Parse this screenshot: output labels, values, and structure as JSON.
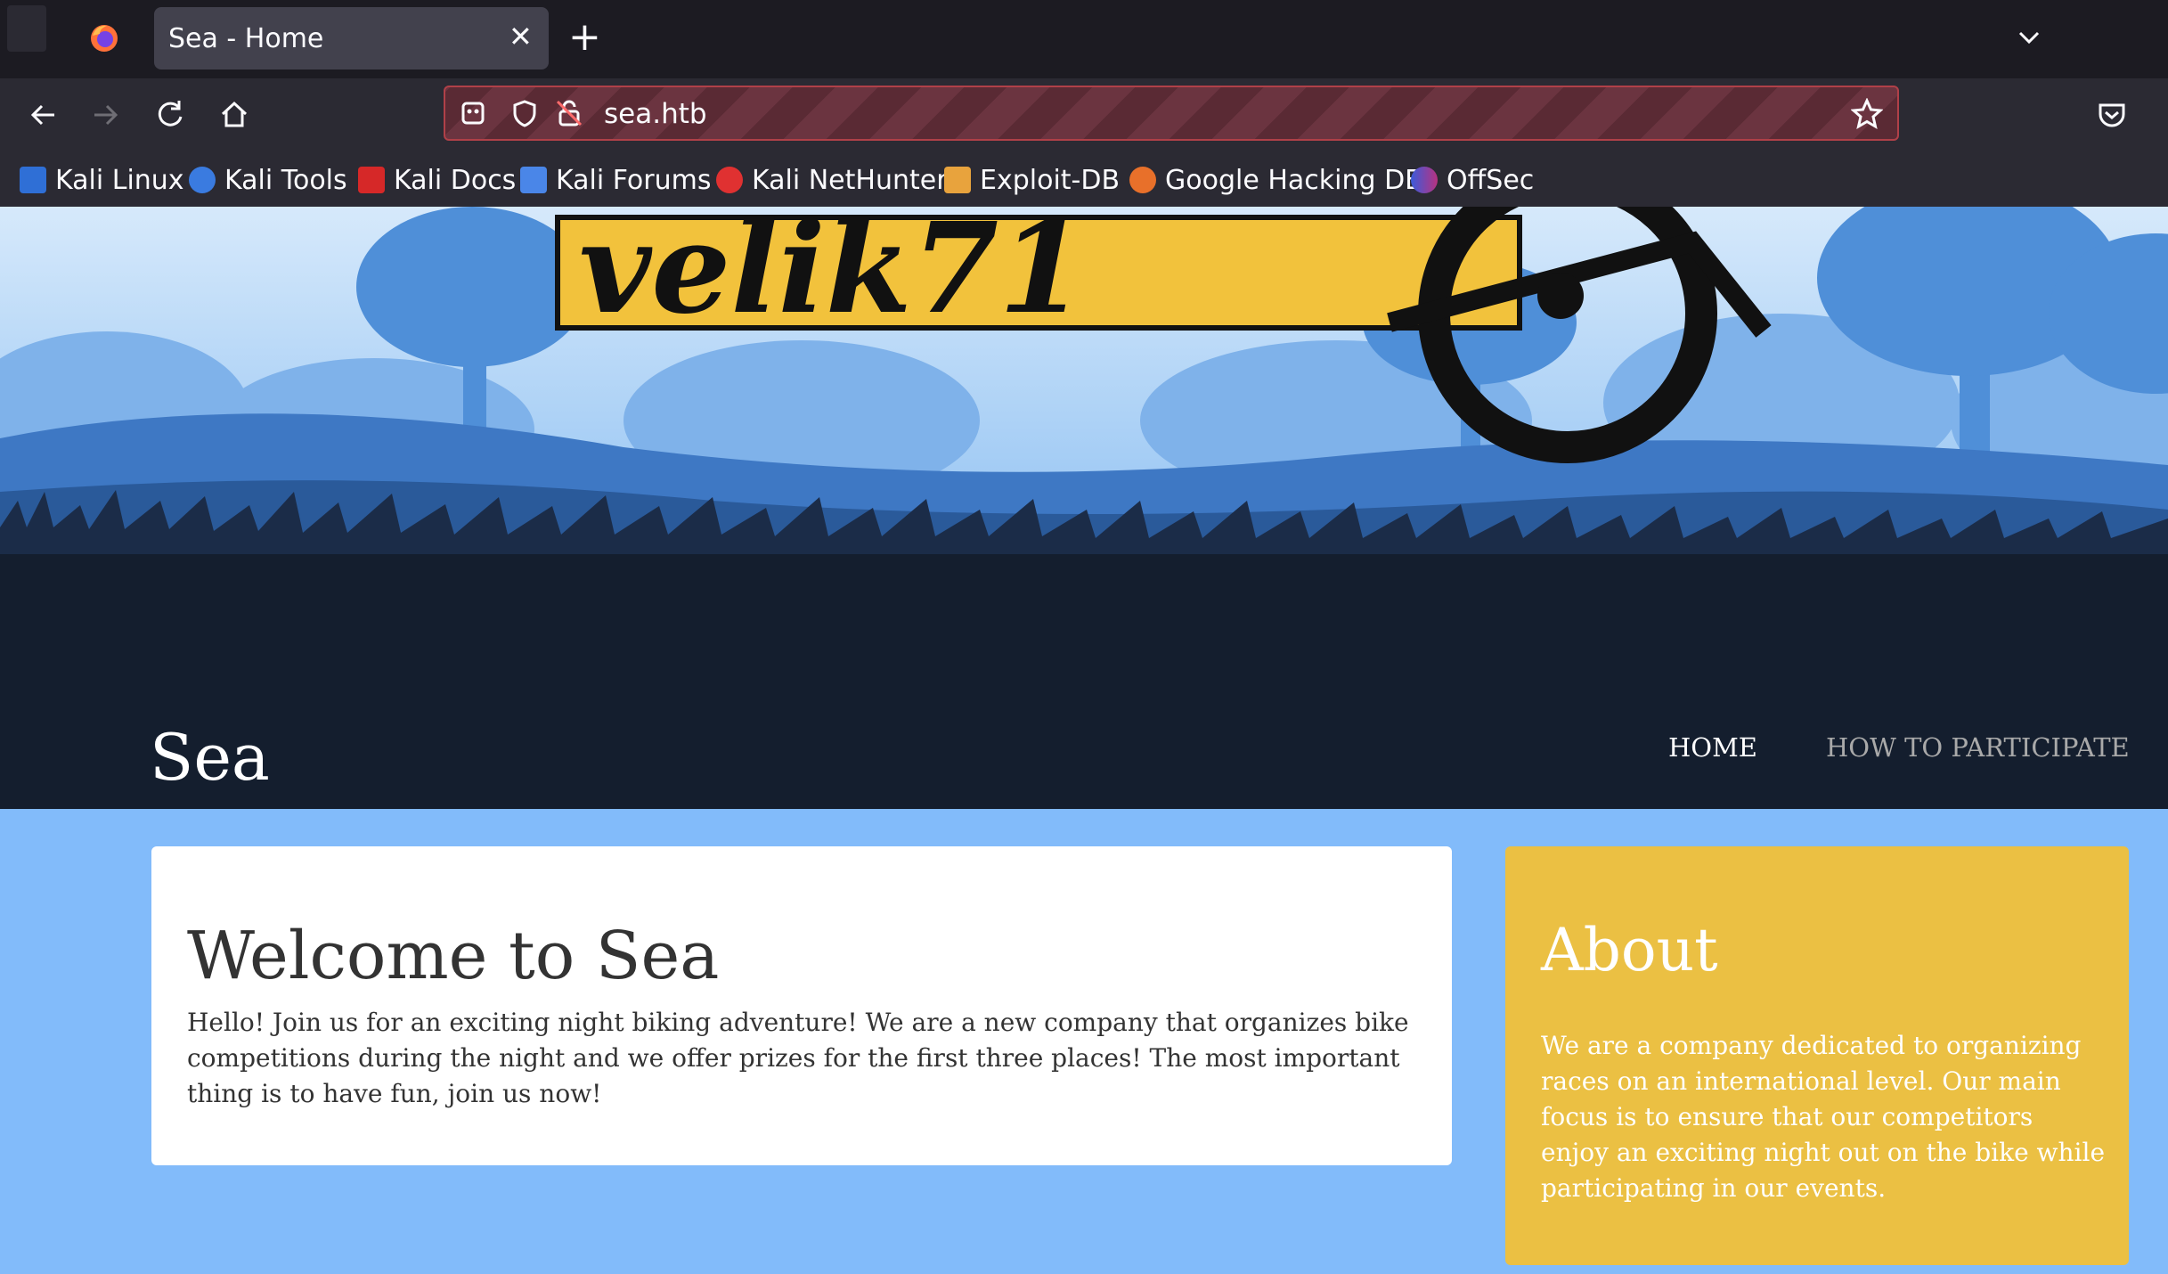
{
  "browser": {
    "tab": {
      "title": "Sea - Home",
      "close_icon": "close-icon"
    },
    "new_tab_label": "+",
    "url": "sea.htb",
    "bookmarks": [
      {
        "label": "Kali Linux",
        "icon": "kali-dragon-icon"
      },
      {
        "label": "Kali Tools",
        "icon": "kali-tools-icon"
      },
      {
        "label": "Kali Docs",
        "icon": "kali-docs-icon"
      },
      {
        "label": "Kali Forums",
        "icon": "kali-forums-icon"
      },
      {
        "label": "Kali NetHunter",
        "icon": "nethunter-icon"
      },
      {
        "label": "Exploit-DB",
        "icon": "exploit-db-icon"
      },
      {
        "label": "Google Hacking DB",
        "icon": "ghdb-icon"
      },
      {
        "label": "OffSec",
        "icon": "offsec-icon"
      }
    ]
  },
  "site": {
    "banner_logo_text": "velik71",
    "title": "Sea",
    "nav": [
      {
        "label": "HOME",
        "active": true
      },
      {
        "label": "HOW TO PARTICIPATE",
        "active": false
      }
    ],
    "welcome": {
      "heading": "Welcome to Sea",
      "body": "Hello! Join us for an exciting night biking adventure! We are a new company that organizes bike competitions during the night and we offer prizes for the first three places! The most important thing is to have fun, join us now!"
    },
    "about": {
      "heading": "About",
      "body": "We are a company dedicated to organizing races on an international level. Our main focus is to ensure that our competitors enjoy an exciting night out on the bike while participating in our events."
    }
  },
  "colors": {
    "page_bg": "#82bbfa",
    "header_bg": "#141e2e",
    "about_bg": "#ebc043",
    "logo_yellow": "#f2c23c"
  }
}
